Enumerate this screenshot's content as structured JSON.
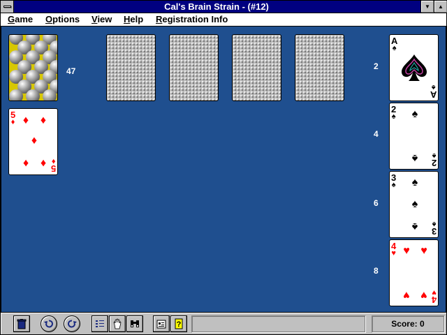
{
  "window": {
    "title": "Cal's Brain Strain - (#12)"
  },
  "menu": {
    "items": [
      {
        "key": "G",
        "rest": "ame"
      },
      {
        "key": "O",
        "rest": "ptions"
      },
      {
        "key": "V",
        "rest": "iew"
      },
      {
        "key": "H",
        "rest": "elp"
      },
      {
        "key": "R",
        "rest": "egistration Info"
      }
    ]
  },
  "deck": {
    "count": "47"
  },
  "waste_card": {
    "rank": "5",
    "suit": "♦"
  },
  "foundations": [
    {
      "rank": "A",
      "suit": "♠",
      "label": "2"
    },
    {
      "rank": "2",
      "suit": "♠",
      "label": "4"
    },
    {
      "rank": "3",
      "suit": "♠",
      "label": "6"
    },
    {
      "rank": "4",
      "suit": "♥",
      "label": "8"
    }
  ],
  "status": {
    "score_label": "Score:",
    "score_value": "0"
  },
  "colors": {
    "table": "#1f4f8f",
    "title_bar": "#000080",
    "red_suit": "#ff0000"
  },
  "toolbar_icons": [
    "trash-icon",
    "undo-icon",
    "redo-icon",
    "options-list-icon",
    "hand-icon",
    "binoculars-icon",
    "stats-icon",
    "help-icon"
  ]
}
